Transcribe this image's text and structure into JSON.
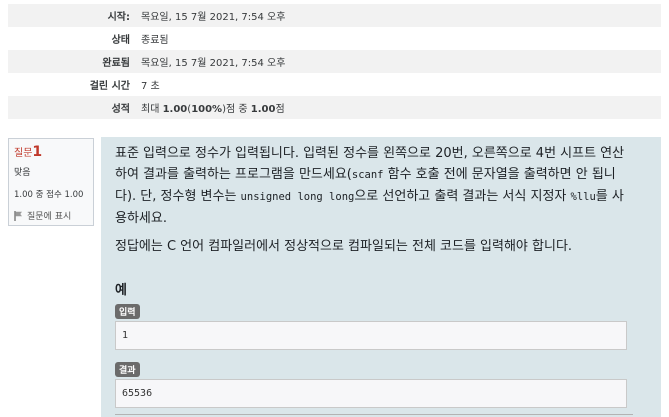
{
  "summary": {
    "rows": [
      {
        "label": "시작:",
        "value": "목요일, 15 7월 2021, 7:54 오후"
      },
      {
        "label": "상태",
        "value": "종료됨"
      },
      {
        "label": "완료됨",
        "value": "목요일, 15 7월 2021, 7:54 오후"
      },
      {
        "label": "걸린 시간",
        "value": "7 초"
      },
      {
        "label": "성적",
        "value_prefix": "최대 ",
        "value_bold1": "1.00",
        "value_paren": "(",
        "value_bold2": "100%",
        "value_paren2": ")",
        "value_mid": "점 중 ",
        "value_bold3": "1.00",
        "value_suffix": "점"
      }
    ]
  },
  "question": {
    "label": "질문",
    "number": "1",
    "state": "맞음",
    "grade": "1.00 중 점수 1.00",
    "flag_label": "질문에 표시",
    "flag_icon": "flag-icon"
  },
  "content": {
    "p1_a": "표준 입력으로 정수가 입력됩니다. 입력된 정수를 왼쪽으로 20번, 오른쪽으로 4번 시프트 연산하여 결과를 출력하는 프로그램을 만드세요(",
    "p1_code1": "scanf",
    "p1_b": " 함수 호출 전에 문자열을 출력하면 안 됩니다). 단, 정수형 변수는 ",
    "p1_code2": "unsigned long long",
    "p1_c": "으로 선언하고 출력 결과는 서식 지정자 ",
    "p1_code3": "%llu",
    "p1_d": "를 사용하세요.",
    "p2": "정답에는 C 언어 컴파일러에서 정상적으로 컴파일되는 전체 코드를 입력해야 합니다.",
    "example_title": "예",
    "input_badge": "입력",
    "input_value": "1",
    "output_badge": "결과",
    "output_value": "65536"
  }
}
